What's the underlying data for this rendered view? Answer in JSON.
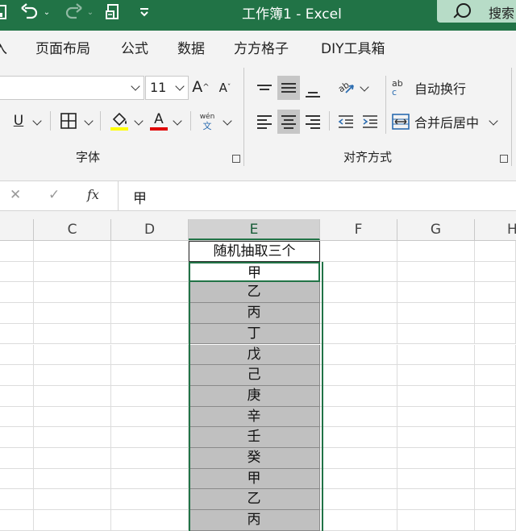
{
  "titlebar": {
    "title": "工作簿1  -  Excel",
    "search_label": "搜索",
    "icons": [
      "save-icon",
      "undo-icon",
      "redo-icon",
      "print-preview-icon",
      "customize-qat-icon"
    ]
  },
  "ribbon_tabs": [
    "入",
    "页面布局",
    "公式",
    "数据",
    "方方格子",
    "DIY工具箱"
  ],
  "font_group": {
    "font_size": "11",
    "grow_label": "A",
    "shrink_label": "A",
    "underline_label": "U",
    "font_color_label": "A",
    "phonetic_top": "wén",
    "phonetic_bottom": "文",
    "group_label": "字体",
    "fill_color": "#ffff00",
    "font_color": "#e00000"
  },
  "alignment_group": {
    "wrap_text_label": "自动换行",
    "wrap_text_glyph_top": "ab",
    "wrap_text_glyph_bottom": "c",
    "merge_center_label": "合并后居中",
    "group_label": "对齐方式"
  },
  "formula_bar": {
    "cancel_glyph": "✕",
    "enter_glyph": "✓",
    "fx_label": "fx",
    "content": "甲"
  },
  "columns": [
    "C",
    "D",
    "E",
    "F",
    "G",
    "H"
  ],
  "active_column": "E",
  "column_e_values": [
    "随机抽取三个",
    "甲",
    "乙",
    "丙",
    "丁",
    "戊",
    "己",
    "庚",
    "辛",
    "壬",
    "癸",
    "甲",
    "乙",
    "丙"
  ],
  "colors": {
    "excel_green": "#217346",
    "selection_fill": "#c0c0c0"
  }
}
